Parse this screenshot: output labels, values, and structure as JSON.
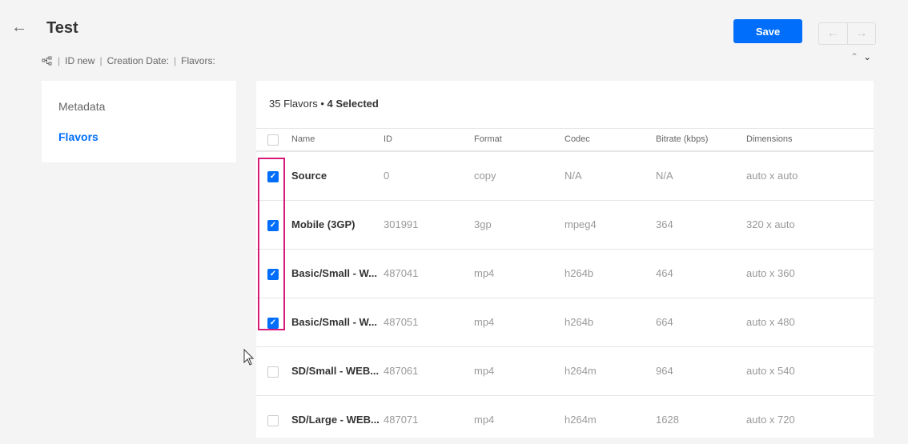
{
  "header": {
    "title": "Test",
    "back_icon": "arrow-left-icon",
    "meta": {
      "id_label": "ID new",
      "creation_label": "Creation Date:",
      "flavors_label": "Flavors:"
    },
    "save_label": "Save"
  },
  "sidebar": {
    "items": [
      {
        "label": "Metadata",
        "active": false
      },
      {
        "label": "Flavors",
        "active": true
      }
    ]
  },
  "panel": {
    "count_text": "35 Flavors",
    "selected_text": "4 Selected",
    "columns": [
      "Name",
      "ID",
      "Format",
      "Codec",
      "Bitrate (kbps)",
      "Dimensions"
    ],
    "rows": [
      {
        "selected": true,
        "name": "Source",
        "id": "0",
        "format": "copy",
        "codec": "N/A",
        "bitrate": "N/A",
        "dimensions": "auto x auto"
      },
      {
        "selected": true,
        "name": "Mobile (3GP)",
        "id": "301991",
        "format": "3gp",
        "codec": "mpeg4",
        "bitrate": "364",
        "dimensions": "320 x auto"
      },
      {
        "selected": true,
        "name": "Basic/Small - W...",
        "id": "487041",
        "format": "mp4",
        "codec": "h264b",
        "bitrate": "464",
        "dimensions": "auto x 360"
      },
      {
        "selected": true,
        "name": "Basic/Small - W...",
        "id": "487051",
        "format": "mp4",
        "codec": "h264b",
        "bitrate": "664",
        "dimensions": "auto x 480"
      },
      {
        "selected": false,
        "name": "SD/Small - WEB...",
        "id": "487061",
        "format": "mp4",
        "codec": "h264m",
        "bitrate": "964",
        "dimensions": "auto x 540"
      },
      {
        "selected": false,
        "name": "SD/Large - WEB...",
        "id": "487071",
        "format": "mp4",
        "codec": "h264m",
        "bitrate": "1628",
        "dimensions": "auto x 720"
      }
    ]
  },
  "colors": {
    "accent": "#006efa",
    "highlight": "#d81b7a"
  }
}
